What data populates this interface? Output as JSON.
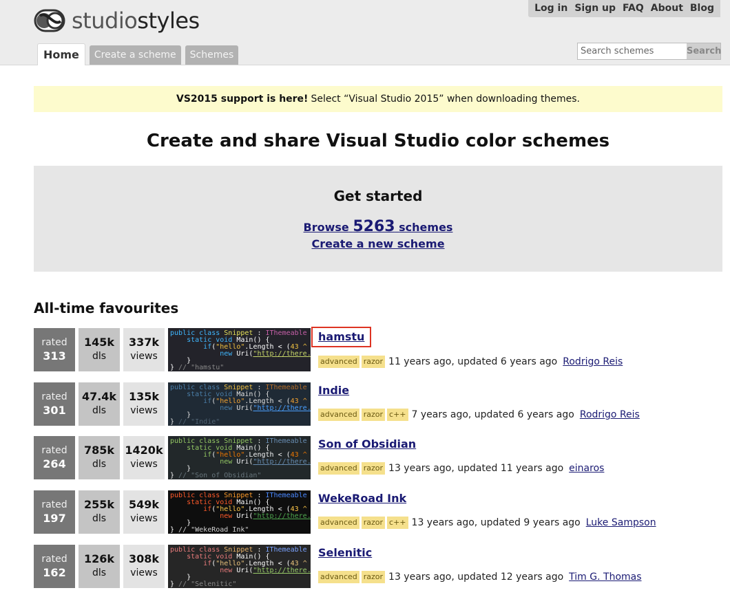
{
  "header": {
    "logo": {
      "light": "studio",
      "bold": "styles"
    },
    "topnav": [
      "Log in",
      "Sign up",
      "FAQ",
      "About",
      "Blog"
    ],
    "tabs": [
      "Home",
      "Create a scheme",
      "Schemes"
    ],
    "search": {
      "placeholder": "Search schemes",
      "button": "Search"
    }
  },
  "notice": {
    "bold": "VS2015 support is here!",
    "text": "Select “Visual Studio 2015” when downloading themes."
  },
  "headline": "Create and share Visual Studio color schemes",
  "get_started": {
    "title": "Get started",
    "browse_pre": "Browse",
    "browse_count": "5263",
    "browse_post": "schemes",
    "create": "Create a new scheme"
  },
  "favourites_title": "All-time favourites",
  "schemes": [
    {
      "rated_label": "rated",
      "rating": "313",
      "dls": "145k",
      "dls_label": "dls",
      "views": "337k",
      "views_label": "views",
      "name": "hamstu",
      "tags": [
        "advanced",
        "razor"
      ],
      "time": "11 years ago, updated 6 years ago",
      "author": "Rodrigo Reis",
      "theme": {
        "bg": "#23232a",
        "kw": "#3fb7ff",
        "cls": "#e4e05a",
        "iface": "#c55fa7",
        "str": "#f0c040",
        "txt": "#ffffff",
        "url": "#c8d86a",
        "com": "#888888"
      }
    },
    {
      "rated_label": "rated",
      "rating": "301",
      "dls": "47.4k",
      "dls_label": "dls",
      "views": "135k",
      "views_label": "views",
      "name": "Indie",
      "tags": [
        "advanced",
        "razor",
        "c++"
      ],
      "time": "7 years ago, updated 6 years ago",
      "author": "Rodrigo Reis",
      "theme": {
        "bg": "#1f2a35",
        "kw": "#4a7ea8",
        "cls": "#f0c040",
        "iface": "#b26d2a",
        "str": "#f0a030",
        "txt": "#e0e0e0",
        "url": "#4aa0ff",
        "com": "#4f6272"
      }
    },
    {
      "rated_label": "rated",
      "rating": "264",
      "dls": "785k",
      "dls_label": "dls",
      "views": "1420k",
      "views_label": "views",
      "name": "Son of Obsidian",
      "tags": [
        "advanced",
        "razor"
      ],
      "time": "13 years ago, updated 11 years ago",
      "author": "einaros",
      "theme": {
        "bg": "#22282a",
        "kw": "#93c763",
        "cls": "#93c763",
        "iface": "#678cb1",
        "str": "#ec7600",
        "txt": "#f1f2f3",
        "url": "#678cb1",
        "com": "#66747b"
      }
    },
    {
      "rated_label": "rated",
      "rating": "197",
      "dls": "255k",
      "dls_label": "dls",
      "views": "549k",
      "views_label": "views",
      "name": "WekeRoad Ink",
      "tags": [
        "advanced",
        "razor",
        "c++"
      ],
      "time": "13 years ago, updated 9 years ago",
      "author": "Luke Sampson",
      "theme": {
        "bg": "#0e0e0e",
        "kw": "#ff5a2a",
        "cls": "#ff9c2a",
        "iface": "#4a88ff",
        "str": "#ffc84a",
        "txt": "#ffffff",
        "url": "#4fa84f",
        "com": "#d0d0d0"
      }
    },
    {
      "rated_label": "rated",
      "rating": "162",
      "dls": "126k",
      "dls_label": "dls",
      "views": "308k",
      "views_label": "views",
      "name": "Selenitic",
      "tags": [
        "advanced",
        "razor"
      ],
      "time": "13 years ago, updated 12 years ago",
      "author": "Tim G. Thomas",
      "theme": {
        "bg": "#262626",
        "kw": "#e87b7b",
        "cls": "#eab56b",
        "iface": "#7aa2ff",
        "str": "#e8c27b",
        "txt": "#ffffff",
        "url": "#9acd6a",
        "com": "#888888"
      }
    }
  ]
}
